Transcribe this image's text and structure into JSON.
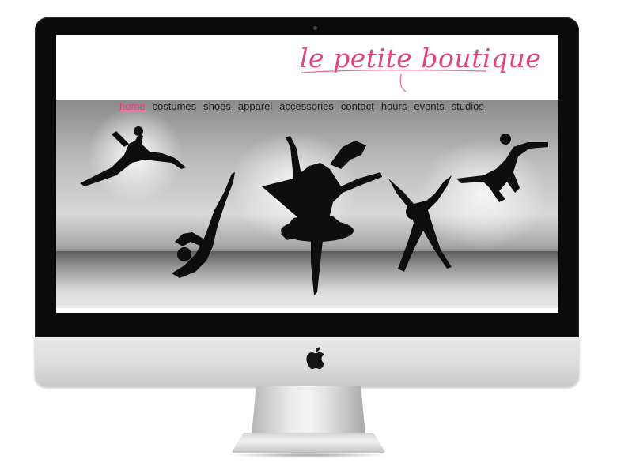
{
  "site": {
    "logo_text": "le petite boutique",
    "accent_color": "#e0457f"
  },
  "nav": {
    "items": [
      {
        "label": "home",
        "active": true
      },
      {
        "label": "costumes"
      },
      {
        "label": "shoes"
      },
      {
        "label": "apparel"
      },
      {
        "label": "accessories"
      },
      {
        "label": "contact"
      },
      {
        "label": "hours"
      },
      {
        "label": "events"
      },
      {
        "label": "studios"
      }
    ]
  },
  "device": {
    "logo_icon": "apple-icon"
  }
}
